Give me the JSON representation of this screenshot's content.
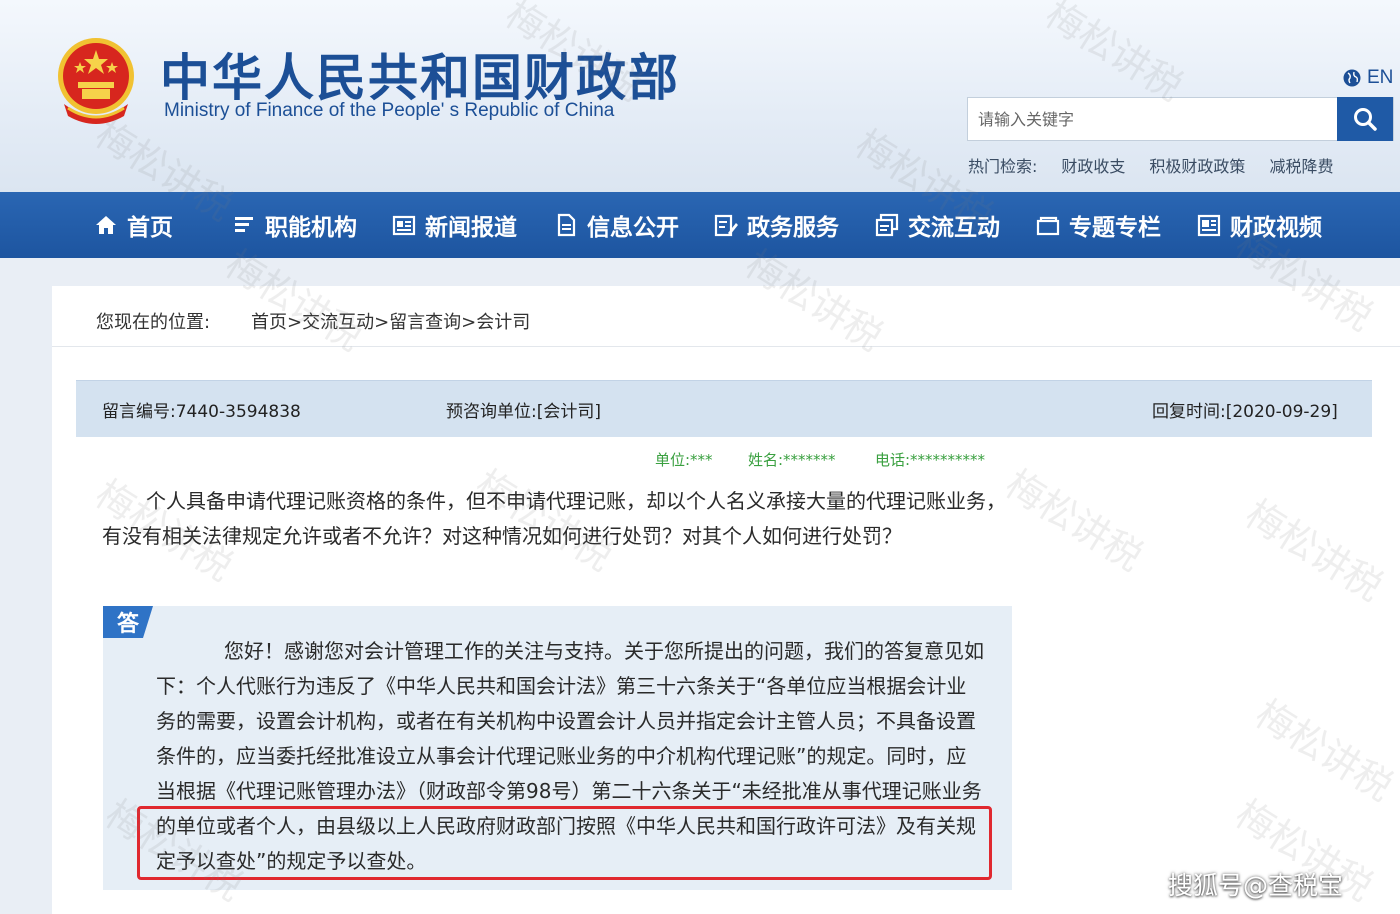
{
  "header": {
    "title_cn": "中华人民共和国财政部",
    "title_en": "Ministry of Finance of the People' s Republic of China",
    "lang_label": "EN",
    "search_placeholder": "请输入关键字",
    "hot_label": "热门检索:",
    "hot_terms": [
      "财政收支",
      "积极财政政策",
      "减税降费"
    ]
  },
  "nav": {
    "items": [
      {
        "label": "首页",
        "icon": "home-icon"
      },
      {
        "label": "职能机构",
        "icon": "list-icon"
      },
      {
        "label": "新闻报道",
        "icon": "news-icon"
      },
      {
        "label": "信息公开",
        "icon": "document-icon"
      },
      {
        "label": "政务服务",
        "icon": "edit-icon"
      },
      {
        "label": "交流互动",
        "icon": "chat-icon"
      },
      {
        "label": "专题专栏",
        "icon": "folder-icon"
      },
      {
        "label": "财政视频",
        "icon": "video-icon"
      }
    ]
  },
  "breadcrumb": {
    "label": "您现在的位置:",
    "path": "首页>交流互动>留言查询>会计司"
  },
  "message": {
    "id": "留言编号:7440-3594838",
    "unit": "预咨询单位:[会计司]",
    "reply_time": "回复时间:[2020-09-29]",
    "meta": {
      "unit": "单位:***",
      "name": "姓名:*******",
      "phone": "电话:**********"
    },
    "question": "个人具备申请代理记账资格的条件，但不申请代理记账，却以个人名义承接大量的代理记账业务，有没有相关法律规定允许或者不允许？对这种情况如何进行处罚？对其个人如何进行处罚？",
    "answer_tag": "答",
    "answer": "您好！感谢您对会计管理工作的关注与支持。关于您所提出的问题，我们的答复意见如下：个人代账行为违反了《中华人民共和国会计法》第三十六条关于“各单位应当根据会计业务的需要，设置会计机构，或者在有关机构中设置会计人员并指定会计主管人员；不具备设置条件的，应当委托经批准设立从事会计代理记账业务的中介机构代理记账”的规定。同时，应当根据《代理记账管理办法》（财政部令第98号）第二十六条关于“未经批准从事代理记账业务的单位或者个人，由县级以上人民政府财政部门按照《中华人民共和国行政许可法》及有关规定予以查处”的规定予以查处。"
  },
  "watermark": {
    "text": "梅松讲税",
    "credit": "搜狐号@查税宝"
  },
  "colors": {
    "brand_blue": "#1d55a0",
    "highlight_red": "#e0282f",
    "meta_green": "#3aa040"
  }
}
